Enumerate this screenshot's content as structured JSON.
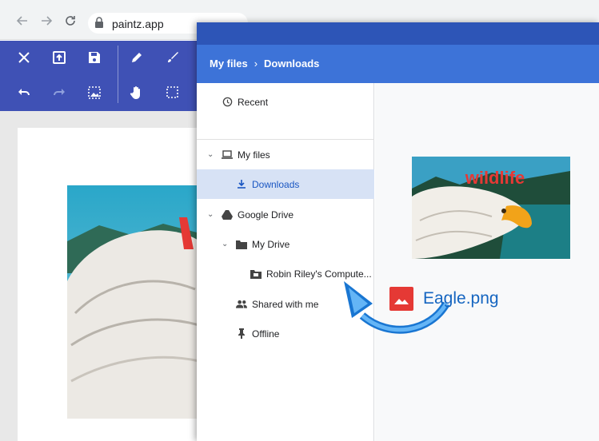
{
  "browser": {
    "url": "paintz.app",
    "icons": [
      "back-arrow-icon",
      "forward-arrow-icon",
      "reload-icon",
      "lock-icon"
    ]
  },
  "paint_toolbar": {
    "accent": "#3f51b5",
    "tools": [
      "close-icon",
      "open-file-icon",
      "save-icon",
      "pencil-icon",
      "brush-icon",
      "undo-icon",
      "redo-icon",
      "image-icon",
      "hand-icon",
      "select-icon"
    ]
  },
  "files_dialog": {
    "breadcrumb": {
      "root": "My files",
      "separator": "›",
      "current": "Downloads"
    },
    "header_color": "#3d73d8",
    "nav": {
      "recent": "Recent",
      "my_files": "My files",
      "downloads": "Downloads",
      "google_drive": "Google Drive",
      "my_drive": "My Drive",
      "computer": "Robin Riley's Compute...",
      "shared": "Shared with me",
      "offline": "Offline"
    },
    "preview_caption": "wildlife"
  },
  "drag": {
    "file_name": "Eagle.png",
    "icon": "image-file-icon"
  }
}
